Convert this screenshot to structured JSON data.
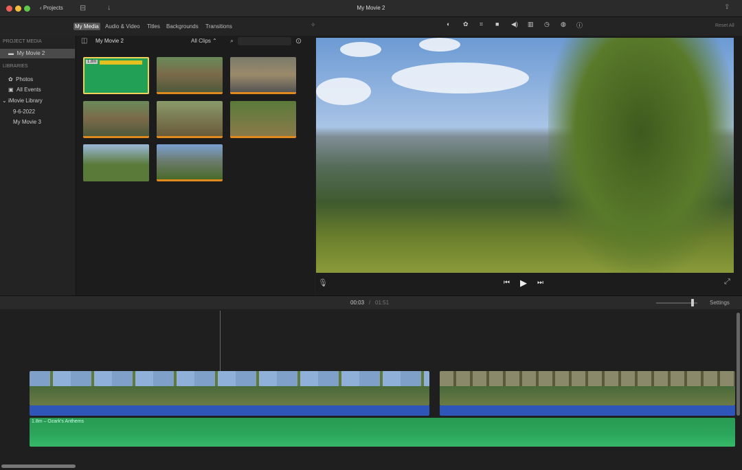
{
  "window": {
    "title": "My Movie 2",
    "back_label": "Projects"
  },
  "tabs": [
    {
      "label": "My Media",
      "active": true
    },
    {
      "label": "Audio & Video"
    },
    {
      "label": "Titles"
    },
    {
      "label": "Backgrounds"
    },
    {
      "label": "Transitions"
    }
  ],
  "viewer_toolbar": {
    "icons": [
      "color-balance-icon",
      "color-correction-icon",
      "crop-icon",
      "stabilization-icon",
      "volume-icon",
      "noise-reduction-icon",
      "speed-icon",
      "clip-filter-icon",
      "info-icon"
    ],
    "reset_label": "Reset All"
  },
  "sidebar": {
    "project_header": "PROJECT MEDIA",
    "project": "My Movie 2",
    "libraries_header": "LIBRARIES",
    "items": [
      "Photos",
      "All Events"
    ],
    "library": "iMovie Library",
    "events": [
      "9-6-2022",
      "My Movie 3"
    ]
  },
  "browser": {
    "title": "My Movie 2",
    "filter": "All Clips",
    "first_clip_duration": "1.8m"
  },
  "timeline": {
    "current_time": "00:03",
    "total_time": "01:51",
    "settings_label": "Settings",
    "music_label": "1.8m – Ozark's Anthems"
  },
  "colors": {
    "audio_blue": "#2e56b8",
    "music_green": "#2aa55a",
    "accent_orange": "#e08a1e"
  }
}
